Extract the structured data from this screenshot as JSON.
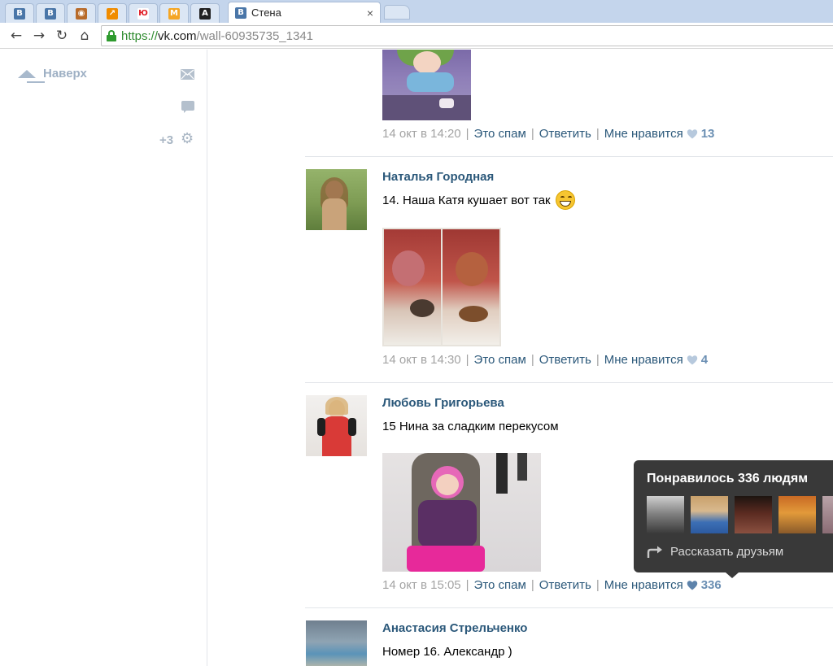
{
  "browser": {
    "tabs": [
      {
        "icon": "vk-icon",
        "glyph": "В",
        "color": "#4a76a8"
      },
      {
        "icon": "vk-icon",
        "glyph": "В",
        "color": "#4a76a8"
      },
      {
        "icon": "dog-icon",
        "glyph": "◉",
        "color": "#b86b2a"
      },
      {
        "icon": "arrow-icon",
        "glyph": "↗",
        "color": "#f08c00"
      },
      {
        "icon": "yu-icon",
        "glyph": "Ю",
        "color": "#e01b24"
      },
      {
        "icon": "m-icon",
        "glyph": "M",
        "color": "#f5a623"
      },
      {
        "icon": "a-icon",
        "glyph": "A",
        "color": "#222222"
      }
    ],
    "active_tab": {
      "glyph": "В",
      "title": "Стена",
      "close": "×"
    },
    "nav": {
      "back": "←",
      "forward": "→",
      "reload": "↻",
      "home": "⌂"
    },
    "url": {
      "scheme": "https://",
      "host": "vk.com",
      "path": "/wall-60935735_1341"
    }
  },
  "sidebar": {
    "up_label": "Наверх",
    "counter": "+3",
    "gear": "⚙"
  },
  "posts": [
    {
      "date": "14 окт в 14:20",
      "spam": "Это спам",
      "reply": "Ответить",
      "like": "Мне нравится",
      "count": "13"
    },
    {
      "author": "Наталья Городная",
      "text": "14. Наша Катя кушает вот так",
      "date": "14 окт в 14:30",
      "spam": "Это спам",
      "reply": "Ответить",
      "like": "Мне нравится",
      "count": "4"
    },
    {
      "author": "Любовь Григорьева",
      "text": "15 Нина за сладким перекусом",
      "date": "14 окт в 15:05",
      "spam": "Это спам",
      "reply": "Ответить",
      "like": "Мне нравится",
      "count": "336"
    },
    {
      "author": "Анастасия Стрельченко",
      "text": "Номер 16. Александр )"
    }
  ],
  "separator": "|",
  "tooltip": {
    "title": "Понравилось 336 людям",
    "share": "Рассказать друзьям"
  },
  "colors": {
    "link": "#2b587a",
    "like_count": "#6b8fb3",
    "heart": "#b7c9dd",
    "heart_active": "#5d83ab"
  }
}
